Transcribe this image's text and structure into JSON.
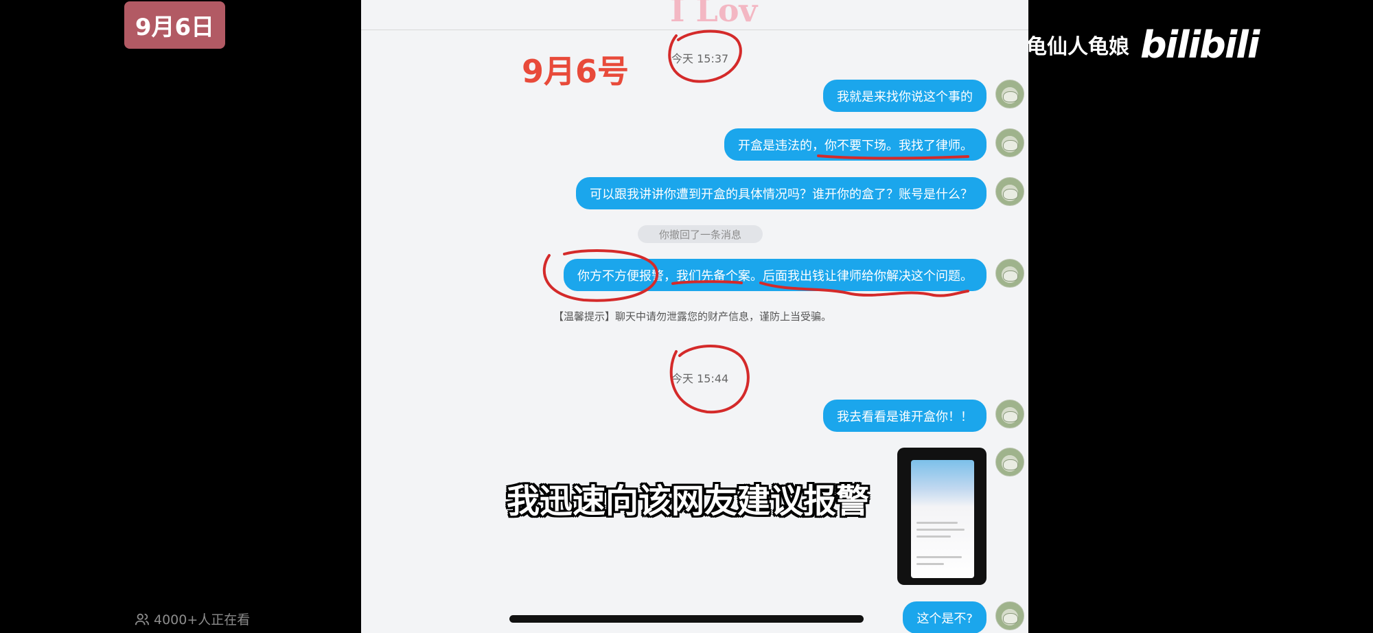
{
  "date_badge": "9月6日",
  "brand": {
    "user": "龟仙人龟娘",
    "logo": "bilibili"
  },
  "viewers": {
    "icon": "people-icon",
    "text": "4000+人正在看"
  },
  "chat": {
    "top_decor": "I Lov",
    "timestamps": [
      "今天 15:37",
      "今天 15:44"
    ],
    "messages": [
      "我就是来找你说这个事的",
      "开盒是违法的，你不要下场。我找了律师。",
      "可以跟我讲讲你遭到开盒的具体情况吗？谁开你的盒了？账号是什么？",
      "你方不方便报警，我们先备个案。后面我出钱让律师给你解决这个问题。",
      "我去看看是谁开盒你！！",
      "这个是不?"
    ],
    "recall_notice": "你撤回了一条消息",
    "tip": "【温馨提示】聊天中请勿泄露您的财产信息，谨防上当受骗。"
  },
  "annotation": {
    "handwritten_date": "9月6号",
    "color": "#e84a3a"
  },
  "subtitle": "我迅速向该网友建议报警",
  "colors": {
    "bubble": "#1ba6ec",
    "badge": "#b25a64",
    "panel": "#f3f4f6"
  }
}
